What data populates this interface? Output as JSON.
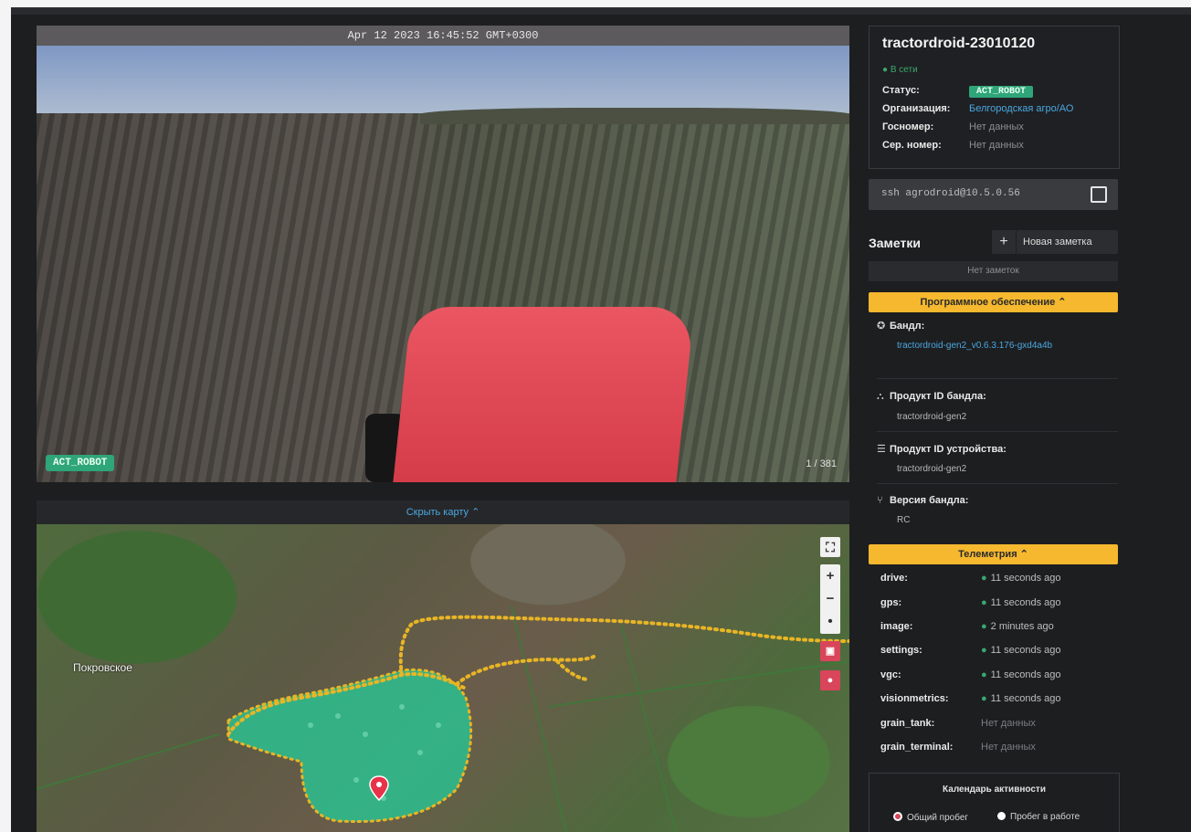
{
  "camera": {
    "timestamp": "Apr 12 2023 16:45:52 GMT+0300",
    "mode_badge": "ACT_ROBOT",
    "frame_counter": "1 / 381"
  },
  "map": {
    "toggle_label": "Скрыть карту ⌃",
    "place_label": "Покровское",
    "controls": {
      "fullscreen": "⛶",
      "zoom_in": "+",
      "zoom_out": "−",
      "north": "•"
    }
  },
  "device": {
    "name": "tractordroid-23010120",
    "online": "● В сети",
    "status_label": "Статус:",
    "status_value": "ACT_ROBOT",
    "org_label": "Организация:",
    "org_value": "Белгородская агро/АО",
    "gos_label": "Госномер:",
    "gos_value": "Нет данных",
    "serial_label": "Сер. номер:",
    "serial_value": "Нет данных"
  },
  "ssh": {
    "command": "ssh agrodroid@10.5.0.56"
  },
  "notes": {
    "title": "Заметки",
    "new_button": "Новая заметка",
    "empty": "Нет заметок"
  },
  "software": {
    "header": "Программное обеспечение ⌃",
    "items": [
      {
        "icon": "✪",
        "label": "Бандл:",
        "value": "tractordroid-gen2_v0.6.3.176-gxd4a4b",
        "link": true
      },
      {
        "icon": "⛬",
        "label": "Продукт ID бандла:",
        "value": "tractordroid-gen2",
        "link": false
      },
      {
        "icon": "☰",
        "label": "Продукт ID устройства:",
        "value": "tractordroid-gen2",
        "link": false
      },
      {
        "icon": "⑂",
        "label": "Версия бандла:",
        "value": "RC",
        "link": false
      }
    ]
  },
  "telemetry": {
    "header": "Телеметрия ⌃",
    "rows": [
      {
        "key": "drive:",
        "value": "11 seconds ago",
        "dot": "●"
      },
      {
        "key": "gps:",
        "value": "11 seconds ago",
        "dot": "●"
      },
      {
        "key": "image:",
        "value": "2 minutes ago",
        "dot": "●"
      },
      {
        "key": "settings:",
        "value": "11 seconds ago",
        "dot": "●"
      },
      {
        "key": "vgc:",
        "value": "11 seconds ago",
        "dot": "●"
      },
      {
        "key": "visionmetrics:",
        "value": "11 seconds ago",
        "dot": "●"
      },
      {
        "key": "grain_tank:",
        "value": "Нет данных",
        "dot": ""
      },
      {
        "key": "grain_terminal:",
        "value": "Нет данных",
        "dot": ""
      }
    ]
  },
  "calendar": {
    "title": "Календарь активности",
    "legend_total": "Общий пробег",
    "legend_work": "Пробег в работе",
    "colors": {
      "total": "#d9455a",
      "work": "#ffffff"
    }
  },
  "colors": {
    "accent_yellow": "#f5b82e",
    "badge_green": "#2fa57a",
    "link_blue": "#4aa8e0",
    "track_yellow": "#e8b525",
    "coverage_teal": "#2bbf8f"
  }
}
